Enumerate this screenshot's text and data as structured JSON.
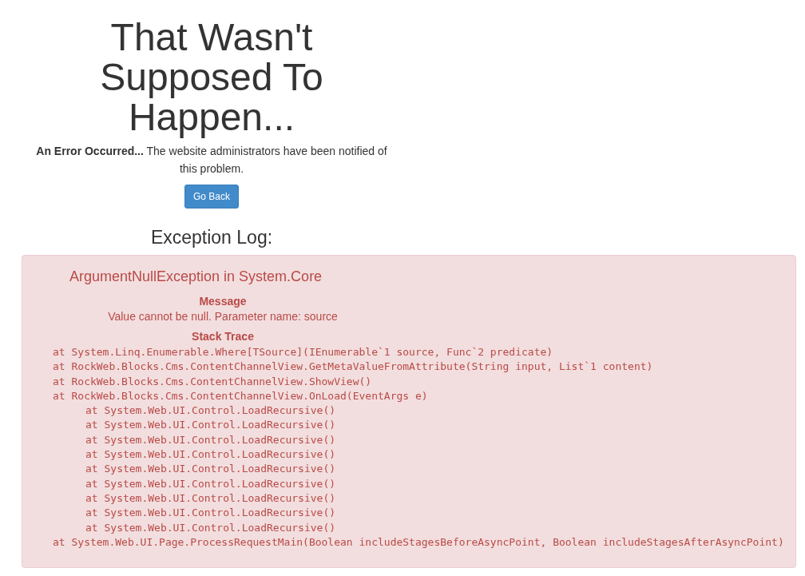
{
  "error_page": {
    "title": "That Wasn't Supposed To Happen...",
    "description": "**An Error Occurred...** The website administrators have been notified of this problem.",
    "button": "Go Back"
  },
  "exception_log": {
    "heading": "Exception Log:",
    "exception_title": "ArgumentNullException in System.Core",
    "message_label": "Message",
    "message": "Value cannot be null. Parameter name: source",
    "stack_trace_label": "Stack Trace",
    "stack_trace": [
      {
        "line": "at System.Linq.Enumerable.Where[TSource](IEnumerable`1 source, Func`2 predicate)"
      },
      {
        "line": "at RockWeb.Blocks.Cms.ContentChannelView.GetMetaValueFromAttribute(String input, List`1 content)"
      },
      {
        "line": "at RockWeb.Blocks.Cms.ContentChannelView.ShowView()"
      },
      {
        "line": "at RockWeb.Blocks.Cms.ContentChannelView.OnLoad(EventArgs e)",
        "children": [
          {
            "line": "at System.Web.UI.Control.LoadRecursive()"
          },
          {
            "line": "at System.Web.UI.Control.LoadRecursive()"
          },
          {
            "line": "at System.Web.UI.Control.LoadRecursive()"
          },
          {
            "line": "at System.Web.UI.Control.LoadRecursive()"
          },
          {
            "line": "at System.Web.UI.Control.LoadRecursive()"
          },
          {
            "line": "at System.Web.UI.Control.LoadRecursive()"
          },
          {
            "line": "at System.Web.UI.Control.LoadRecursive()"
          },
          {
            "line": "at System.Web.UI.Control.LoadRecursive()"
          },
          {
            "line": "at System.Web.UI.Control.LoadRecursive()"
          }
        ]
      },
      {
        "line": "at System.Web.UI.Page.ProcessRequestMain(Boolean includeStagesBeforeAsyncPoint, Boolean includeStagesAfterAsyncPoint)"
      }
    ]
  }
}
